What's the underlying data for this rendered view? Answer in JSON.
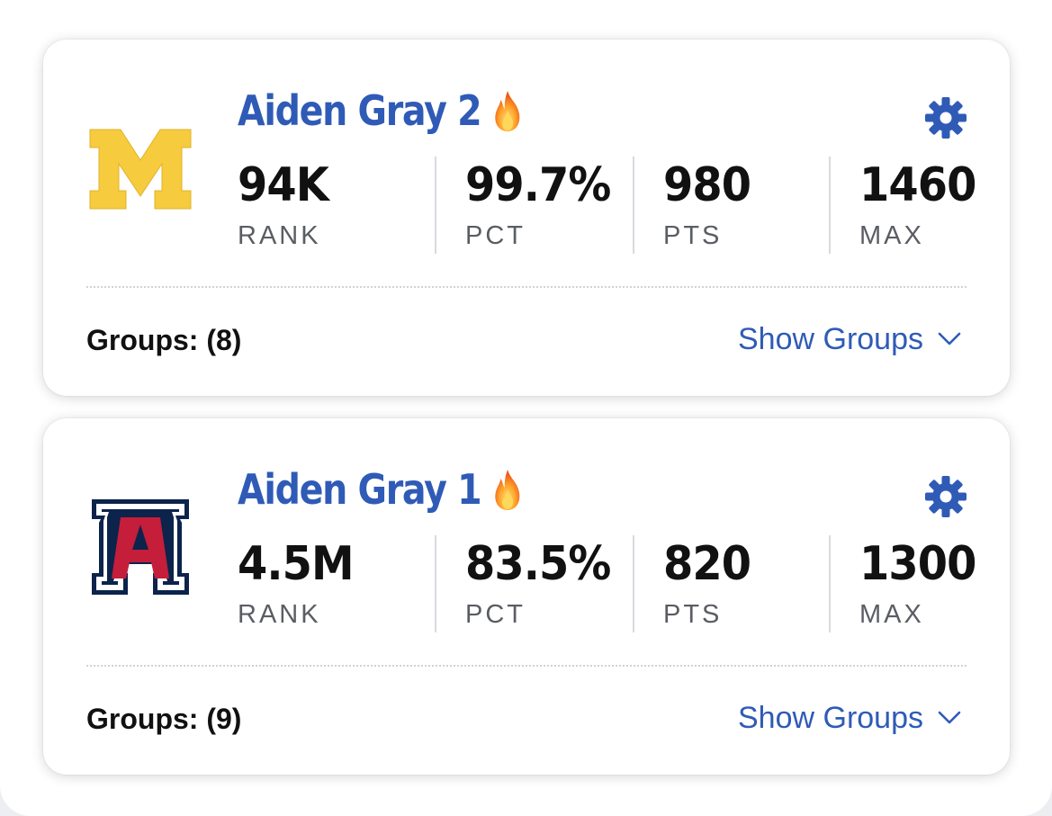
{
  "colors": {
    "accent": "#2f5bb7",
    "michigan_maize": "#f6cb3d",
    "arizona_red": "#c41e3a",
    "arizona_navy": "#0c234b",
    "fire": "#f57c1f"
  },
  "entries": [
    {
      "name": "Aiden Gray 2",
      "logo_icon": "michigan-block-m-logo",
      "badge_icon": "fire-icon",
      "stats": [
        {
          "value": "94K",
          "label": "RANK"
        },
        {
          "value": "99.7%",
          "label": "PCT"
        },
        {
          "value": "980",
          "label": "PTS"
        },
        {
          "value": "1460",
          "label": "MAX"
        }
      ],
      "groups_label": "Groups: (8)",
      "show_groups_label": "Show Groups"
    },
    {
      "name": "Aiden Gray 1",
      "logo_icon": "arizona-block-a-logo",
      "badge_icon": "fire-icon",
      "stats": [
        {
          "value": "4.5M",
          "label": "RANK"
        },
        {
          "value": "83.5%",
          "label": "PCT"
        },
        {
          "value": "820",
          "label": "PTS"
        },
        {
          "value": "1300",
          "label": "MAX"
        }
      ],
      "groups_label": "Groups: (9)",
      "show_groups_label": "Show Groups"
    }
  ]
}
